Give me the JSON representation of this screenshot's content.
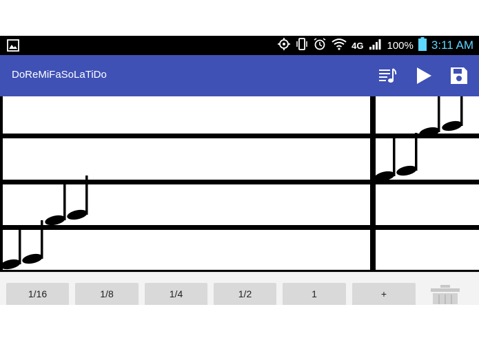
{
  "status_bar": {
    "battery": "100%",
    "network": "4G",
    "time": "3:11 AM",
    "time_color": "#5fd6ff"
  },
  "app_bar": {
    "title": "DoReMiFaSoLaTiDo",
    "color": "#3f51b5",
    "actions": [
      "music-notes-icon",
      "play-icon",
      "save-icon"
    ]
  },
  "staff": {
    "notes": 8
  },
  "note_buttons": [
    "1/16",
    "1/8",
    "1/4",
    "1/2",
    "1",
    "+"
  ],
  "trash_icon": "trash-icon"
}
